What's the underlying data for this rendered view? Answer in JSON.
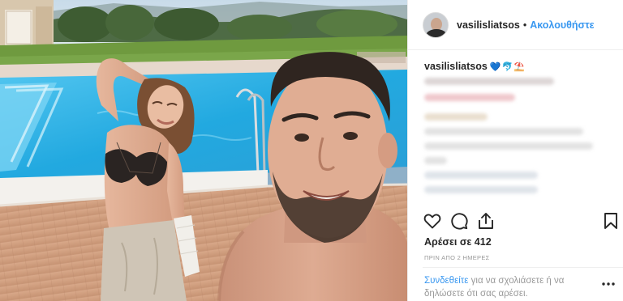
{
  "post": {
    "username": "vasilisliatsos",
    "separator": "•",
    "follow_label": "Ακολουθήστε",
    "caption_user": "vasilisliatsos",
    "caption_emoji": "💙🐬⛱️",
    "likes_label": "Αρέσει σε 412",
    "time_label": "ΠΡΙΝ ΑΠΟ 2 ΗΜΕΡΕΣ",
    "login_link": "Συνδεθείτε",
    "login_text": " για να σχολιάσετε ή να δηλώσετε ότι σας αρέσει."
  },
  "icons": {
    "like": "heart-icon",
    "comment": "comment-icon",
    "share": "share-icon",
    "save": "bookmark-icon",
    "more": "more-options-icon"
  },
  "colors": {
    "link_blue": "#3897f0",
    "text_dark": "#262626",
    "muted": "#999999",
    "pool_water": "#2fb4e6",
    "grass": "#6f9a3f"
  }
}
